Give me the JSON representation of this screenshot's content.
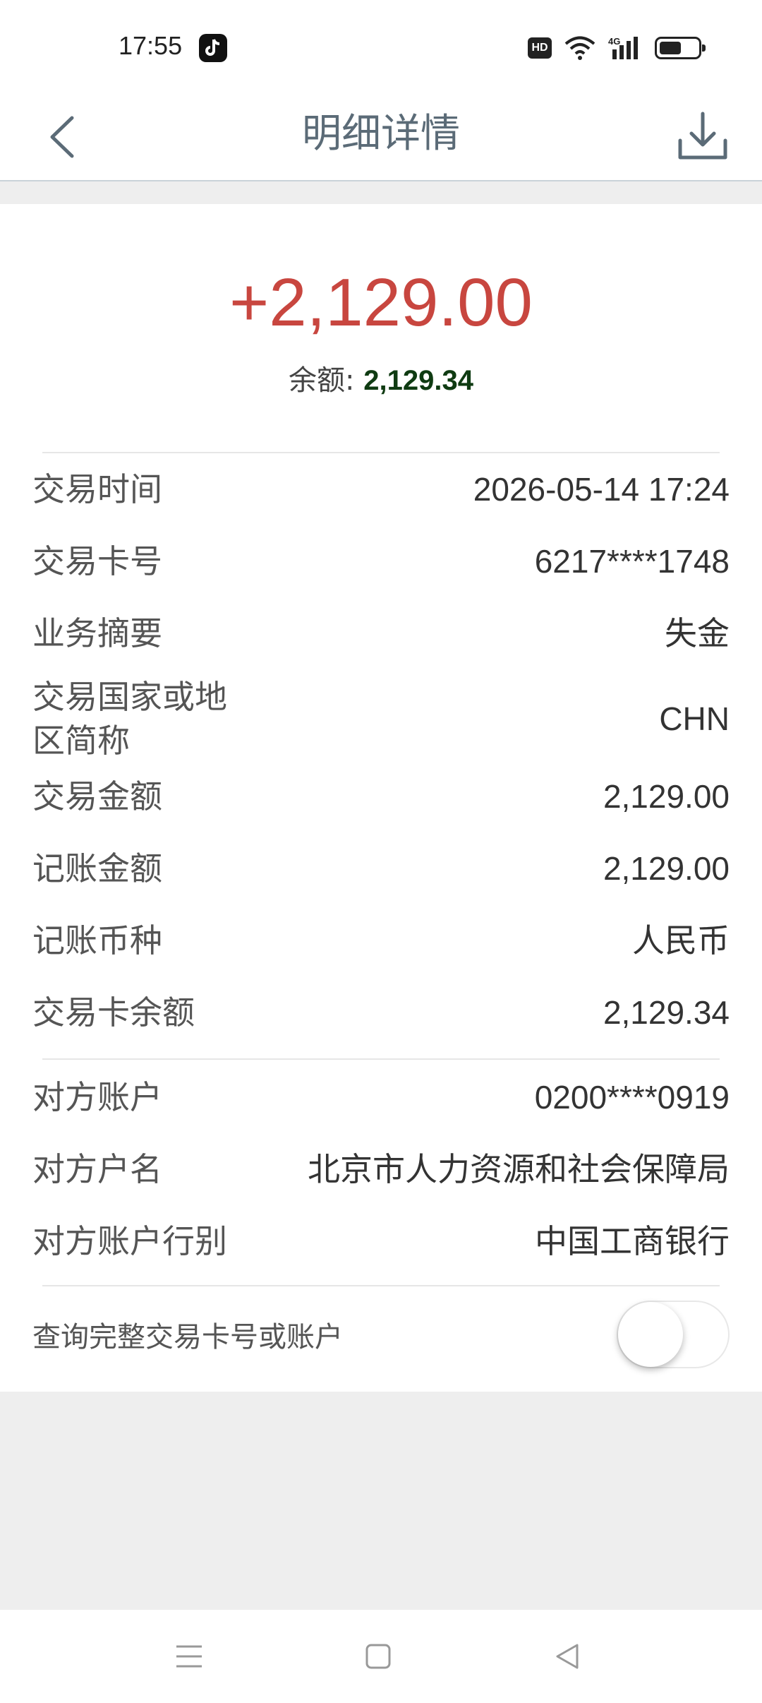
{
  "status_bar": {
    "time": "17:55",
    "hd_label": "HD",
    "battery_level": 0.55,
    "icons": [
      "tiktok-icon",
      "wifi-icon",
      "signal-4g-icon",
      "battery-icon"
    ]
  },
  "header": {
    "title": "明细详情",
    "back_icon": "chevron-left-icon",
    "download_icon": "download-icon"
  },
  "summary": {
    "amount": "+2,129.00",
    "balance_label": "余额: ",
    "balance_value": "2,129.34",
    "amount_color": "#c8463f",
    "balance_color": "#0f3b12"
  },
  "details_group1": [
    {
      "label": "交易时间",
      "value": "2026-05-14 17:24"
    },
    {
      "label": "交易卡号",
      "value": "6217****1748"
    },
    {
      "label": "业务摘要",
      "value": "失金"
    },
    {
      "label": "交易国家或地区简称",
      "value": "CHN"
    },
    {
      "label": "交易金额",
      "value": "2,129.00"
    },
    {
      "label": "记账金额",
      "value": "2,129.00"
    },
    {
      "label": "记账币种",
      "value": "人民币"
    },
    {
      "label": "交易卡余额",
      "value": "2,129.34"
    }
  ],
  "details_group2": [
    {
      "label": "对方账户",
      "value": "0200****0919"
    },
    {
      "label": "对方户名",
      "value": "北京市人力资源和社会保障局"
    },
    {
      "label": "对方账户行别",
      "value": "中国工商银行"
    }
  ],
  "full_number_toggle": {
    "label": "查询完整交易卡号或账户",
    "enabled": false
  },
  "system_nav": {
    "icons": [
      "menu-icon",
      "home-square-icon",
      "back-triangle-icon"
    ]
  }
}
